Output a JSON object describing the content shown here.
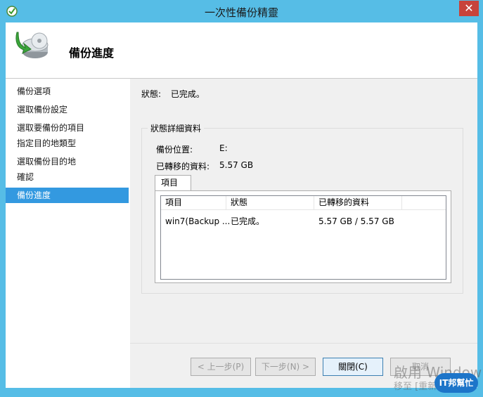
{
  "window": {
    "title": "一次性備份精靈",
    "close_glyph": "✕"
  },
  "header": {
    "title": "備份進度",
    "icon": "backup-disk-icon"
  },
  "sidebar": {
    "items": [
      {
        "label": "備份選項",
        "active": false
      },
      {
        "label": "選取備份設定",
        "active": false
      },
      {
        "label": "選取要備份的項目",
        "active": false
      },
      {
        "label": "指定目的地類型",
        "active": false
      },
      {
        "label": "選取備份目的地",
        "active": false
      },
      {
        "label": "確認",
        "active": false
      },
      {
        "label": "備份進度",
        "active": true
      }
    ]
  },
  "main": {
    "status_label": "狀態:",
    "status_value": "已完成。",
    "group_title": "狀態詳細資料",
    "backup_location_label": "備份位置:",
    "backup_location_value": "E:",
    "transferred_label": "已轉移的資料:",
    "transferred_value": "5.57 GB",
    "tab_label": "項目",
    "columns": [
      "項目",
      "狀態",
      "已轉移的資料"
    ],
    "rows": [
      {
        "item": "win7(Backup ...",
        "status": "已完成。",
        "transferred": "5.57 GB / 5.57 GB"
      }
    ]
  },
  "buttons": {
    "back": "< 上一步(P)",
    "next": "下一步(N) >",
    "close": "關閉(C)",
    "cancel": "取消"
  },
  "watermark": {
    "line1": "啟用 Window",
    "line2": "移至 [重新",
    "badge": "IT邦幫忙"
  },
  "colors": {
    "title_bar": "#56bde6",
    "active_nav": "#3399e0",
    "close_button": "#c7433b"
  }
}
